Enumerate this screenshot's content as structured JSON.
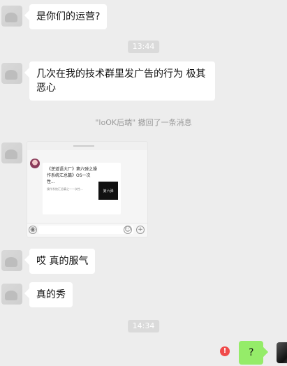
{
  "messages": {
    "m1": "是你们的运营?",
    "m2": "几次在我的技术群里发广告的行为 极其恶心",
    "m3": "哎 真的服气",
    "m4": "真的秀"
  },
  "timestamps": {
    "t1": "13:44",
    "t2": "14:34"
  },
  "system_notice": "\"loOK后端\" 撤回了一条消息",
  "screenshot": {
    "card_title": "《逆道语大厂》第六弹之操作系统汇总篇》OS一次性...",
    "card_subtitle": "操作系统汇总篇之一一次性...",
    "card_thumb_text": "第六弹",
    "input_plus_icon": "+",
    "input_voice_icon": "◉"
  },
  "my_message": "?",
  "error_badge": "!",
  "colors": {
    "background": "#ededed",
    "my_bubble": "#95ec69",
    "error": "#f04a4a"
  }
}
